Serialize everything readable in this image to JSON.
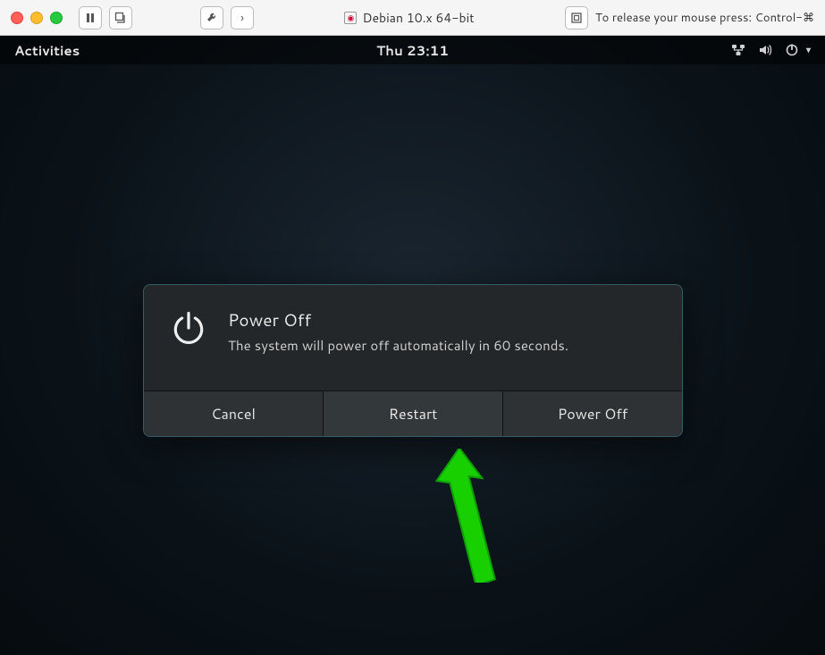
{
  "chrome": {
    "vm_title": "Debian 10.x 64-bit",
    "release_hint": "To release your mouse press: Control-⌘"
  },
  "gnome": {
    "activities": "Activities",
    "clock": "Thu 23:11"
  },
  "dialog": {
    "title": "Power Off",
    "message": "The system will power off automatically in 60 seconds.",
    "buttons": {
      "cancel": "Cancel",
      "restart": "Restart",
      "poweroff": "Power Off"
    }
  }
}
